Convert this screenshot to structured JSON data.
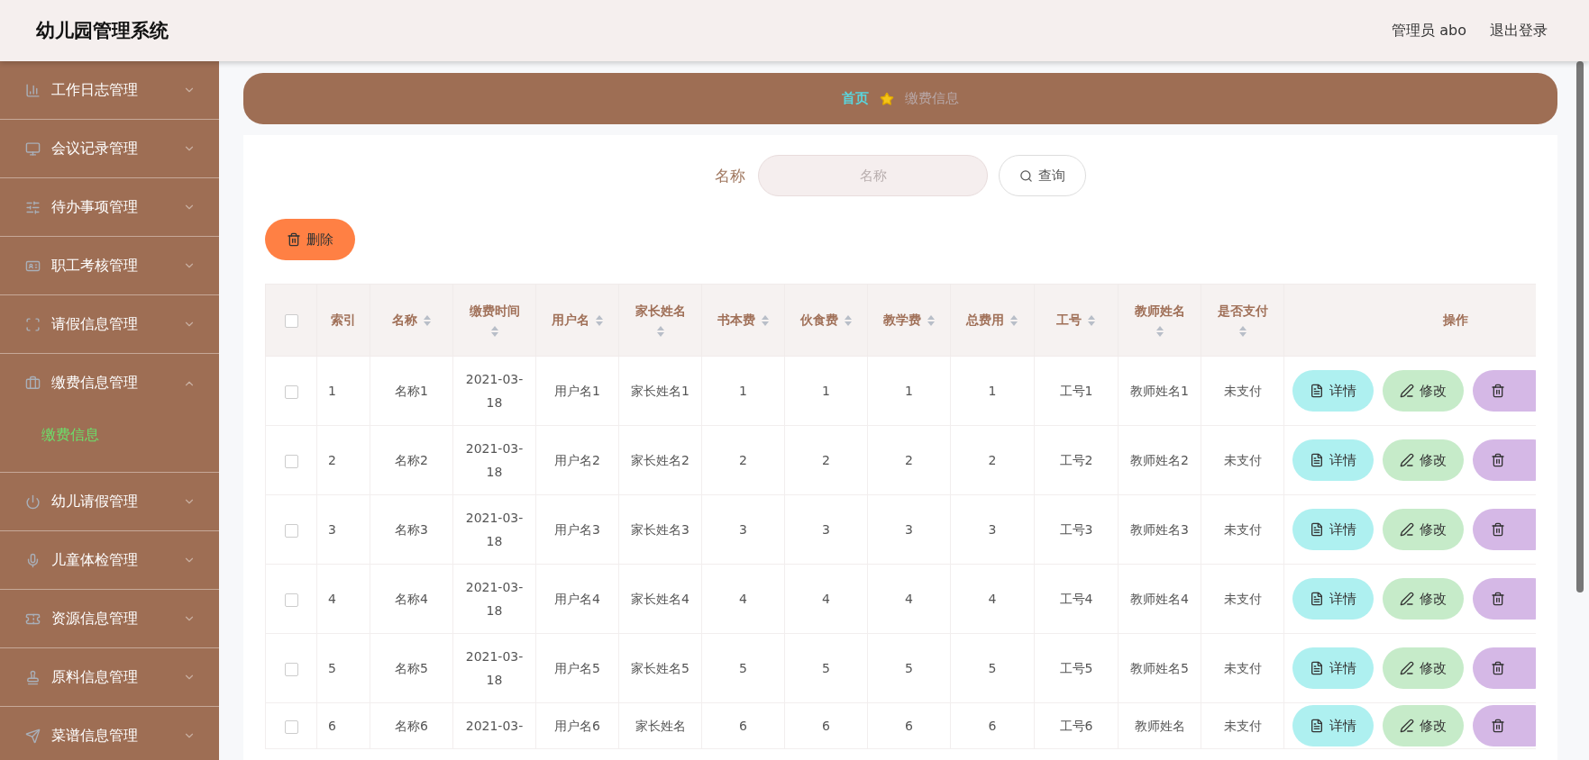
{
  "header": {
    "title": "幼儿园管理系统",
    "user": "管理员 abo",
    "logout": "退出登录"
  },
  "sidebar": {
    "items": [
      {
        "label": "工作日志管理",
        "expanded": false
      },
      {
        "label": "会议记录管理",
        "expanded": false
      },
      {
        "label": "待办事项管理",
        "expanded": false
      },
      {
        "label": "职工考核管理",
        "expanded": false
      },
      {
        "label": "请假信息管理",
        "expanded": false
      },
      {
        "label": "缴费信息管理",
        "expanded": true,
        "children": [
          {
            "label": "缴费信息",
            "selected": true
          }
        ]
      },
      {
        "label": "幼儿请假管理",
        "expanded": false
      },
      {
        "label": "儿童体检管理",
        "expanded": false
      },
      {
        "label": "资源信息管理",
        "expanded": false
      },
      {
        "label": "原料信息管理",
        "expanded": false
      },
      {
        "label": "菜谱信息管理",
        "expanded": false
      }
    ]
  },
  "breadcrumb": {
    "home": "首页",
    "current": "缴费信息"
  },
  "search": {
    "label": "名称",
    "placeholder": "名称",
    "button": "查询"
  },
  "delete_button": "删除",
  "table": {
    "header_checked": false,
    "columns": [
      {
        "label": "索引",
        "sortable": false
      },
      {
        "label": "名称",
        "sortable": true
      },
      {
        "label": "缴费时间",
        "sortable": true
      },
      {
        "label": "用户名",
        "sortable": true
      },
      {
        "label": "家长姓名",
        "sortable": true
      },
      {
        "label": "书本费",
        "sortable": true
      },
      {
        "label": "伙食费",
        "sortable": true
      },
      {
        "label": "教学费",
        "sortable": true
      },
      {
        "label": "总费用",
        "sortable": true
      },
      {
        "label": "工号",
        "sortable": true
      },
      {
        "label": "教师姓名",
        "sortable": true
      },
      {
        "label": "是否支付",
        "sortable": true
      },
      {
        "label": "操作",
        "sortable": false
      }
    ],
    "rows": [
      {
        "checked": false,
        "cells": [
          "1",
          "名称1",
          "2021-03-18",
          "用户名1",
          "家长姓名1",
          "1",
          "1",
          "1",
          "1",
          "工号1",
          "教师姓名1",
          "未支付"
        ],
        "actions": [
          {
            "kind": "detail",
            "label": "详情"
          },
          {
            "kind": "edit",
            "label": "修改"
          },
          {
            "kind": "delete"
          }
        ]
      },
      {
        "checked": false,
        "cells": [
          "2",
          "名称2",
          "2021-03-18",
          "用户名2",
          "家长姓名2",
          "2",
          "2",
          "2",
          "2",
          "工号2",
          "教师姓名2",
          "未支付"
        ],
        "actions": [
          {
            "kind": "detail",
            "label": "详情"
          },
          {
            "kind": "edit",
            "label": "修改"
          },
          {
            "kind": "delete"
          }
        ]
      },
      {
        "checked": false,
        "cells": [
          "3",
          "名称3",
          "2021-03-18",
          "用户名3",
          "家长姓名3",
          "3",
          "3",
          "3",
          "3",
          "工号3",
          "教师姓名3",
          "未支付"
        ],
        "actions": [
          {
            "kind": "detail",
            "label": "详情"
          },
          {
            "kind": "edit",
            "label": "修改"
          },
          {
            "kind": "delete"
          }
        ]
      },
      {
        "checked": false,
        "cells": [
          "4",
          "名称4",
          "2021-03-18",
          "用户名4",
          "家长姓名4",
          "4",
          "4",
          "4",
          "4",
          "工号4",
          "教师姓名4",
          "未支付"
        ],
        "actions": [
          {
            "kind": "detail",
            "label": "详情"
          },
          {
            "kind": "edit",
            "label": "修改"
          },
          {
            "kind": "delete"
          }
        ]
      },
      {
        "checked": false,
        "cells": [
          "5",
          "名称5",
          "2021-03-18",
          "用户名5",
          "家长姓名5",
          "5",
          "5",
          "5",
          "5",
          "工号5",
          "教师姓名5",
          "未支付"
        ],
        "actions": [
          {
            "kind": "detail",
            "label": "详情"
          },
          {
            "kind": "edit",
            "label": "修改"
          },
          {
            "kind": "delete"
          }
        ]
      },
      {
        "checked": false,
        "cells": [
          "6",
          "名称6",
          "2021-03-",
          "用户名6",
          "家长姓名",
          "6",
          "6",
          "6",
          "6",
          "工号6",
          "教师姓名",
          "未支付"
        ],
        "actions": [
          {
            "kind": "detail",
            "label": "详情"
          },
          {
            "kind": "edit",
            "label": "修改"
          },
          {
            "kind": "delete"
          }
        ]
      }
    ]
  }
}
